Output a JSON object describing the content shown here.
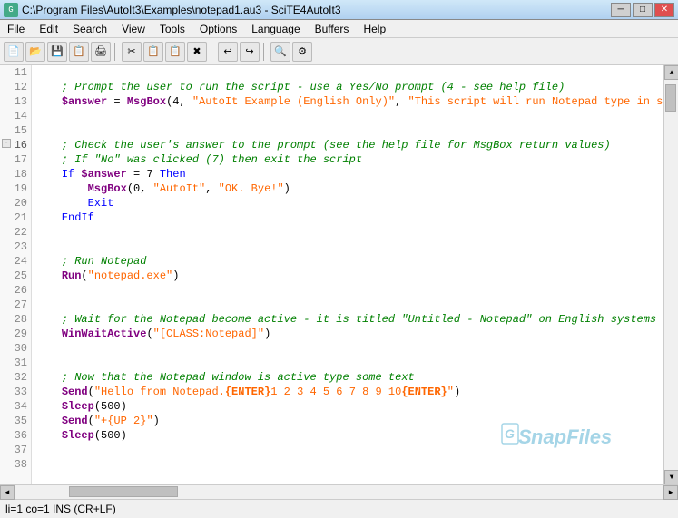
{
  "titlebar": {
    "title": "C:\\Program Files\\AutoIt3\\Examples\\notepad1.au3 - SciTE4AutoIt3",
    "icon": "G"
  },
  "menubar": {
    "items": [
      "File",
      "Edit",
      "Search",
      "View",
      "Tools",
      "Options",
      "Language",
      "Buffers",
      "Help"
    ]
  },
  "toolbar": {
    "buttons": [
      {
        "icon": "📄",
        "name": "new"
      },
      {
        "icon": "📂",
        "name": "open"
      },
      {
        "icon": "💾",
        "name": "save"
      },
      {
        "icon": "📋",
        "name": "copy-path"
      },
      {
        "icon": "🖨",
        "name": "print"
      },
      {
        "icon": "✂",
        "name": "cut"
      },
      {
        "icon": "📋",
        "name": "copy"
      },
      {
        "icon": "📋",
        "name": "paste"
      },
      {
        "icon": "✖",
        "name": "delete"
      },
      {
        "icon": "↩",
        "name": "undo"
      },
      {
        "icon": "↪",
        "name": "redo"
      },
      {
        "icon": "🔍",
        "name": "find"
      },
      {
        "icon": "⚙",
        "name": "settings"
      }
    ]
  },
  "code": {
    "lines": [
      {
        "num": 11,
        "content": "",
        "fold": false
      },
      {
        "num": 12,
        "content": "\t; Prompt the user to run the script - use a Yes/No prompt (4 - see help file)",
        "fold": false
      },
      {
        "num": 13,
        "content": "\t$answer = MsgBox(4, \"AutoIt Example (English Only)\", \"This script will run Notepad type in s",
        "fold": false
      },
      {
        "num": 14,
        "content": "",
        "fold": false
      },
      {
        "num": 15,
        "content": "",
        "fold": false
      },
      {
        "num": 16,
        "content": "\t; Check the user's answer to the prompt (see the help file for MsgBox return values)",
        "fold": true
      },
      {
        "num": 17,
        "content": "\t; If \"No\" was clicked (7) then exit the script",
        "fold": false
      },
      {
        "num": 18,
        "content": "\tIf $answer = 7 Then",
        "fold": false
      },
      {
        "num": 19,
        "content": "\t\tMsgBox(0, \"AutoIt\", \"OK. Bye!\")",
        "fold": false
      },
      {
        "num": 20,
        "content": "\t\tExit",
        "fold": false
      },
      {
        "num": 21,
        "content": "\tEndIf",
        "fold": false
      },
      {
        "num": 22,
        "content": "",
        "fold": false
      },
      {
        "num": 23,
        "content": "",
        "fold": false
      },
      {
        "num": 24,
        "content": "\t; Run Notepad",
        "fold": false
      },
      {
        "num": 25,
        "content": "\tRun(\"notepad.exe\")",
        "fold": false
      },
      {
        "num": 26,
        "content": "",
        "fold": false
      },
      {
        "num": 27,
        "content": "",
        "fold": false
      },
      {
        "num": 28,
        "content": "\t; Wait for the Notepad become active - it is titled \"Untitled - Notepad\" on English systems",
        "fold": false
      },
      {
        "num": 29,
        "content": "\tWinWaitActive(\"[CLASS:Notepad]\")",
        "fold": false
      },
      {
        "num": 30,
        "content": "",
        "fold": false
      },
      {
        "num": 31,
        "content": "",
        "fold": false
      },
      {
        "num": 32,
        "content": "\t; Now that the Notepad window is active type some text",
        "fold": false
      },
      {
        "num": 33,
        "content": "\tSend(\"Hello from Notepad.{ENTER}1 2 3 4 5 6 7 8 9 10{ENTER}\")",
        "fold": false
      },
      {
        "num": 34,
        "content": "\tSleep(500)",
        "fold": false
      },
      {
        "num": 35,
        "content": "\tSend(\"+{UP 2}\")",
        "fold": false
      },
      {
        "num": 36,
        "content": "\tSleep(500)",
        "fold": false
      },
      {
        "num": 37,
        "content": "",
        "fold": false
      },
      {
        "num": 38,
        "content": "",
        "fold": false
      }
    ]
  },
  "statusbar": {
    "text": "li=1 co=1 INS (CR+LF)"
  },
  "scrollbar": {
    "vscroll_up": "▲",
    "vscroll_down": "▼",
    "hscroll_left": "◄",
    "hscroll_right": "►"
  }
}
